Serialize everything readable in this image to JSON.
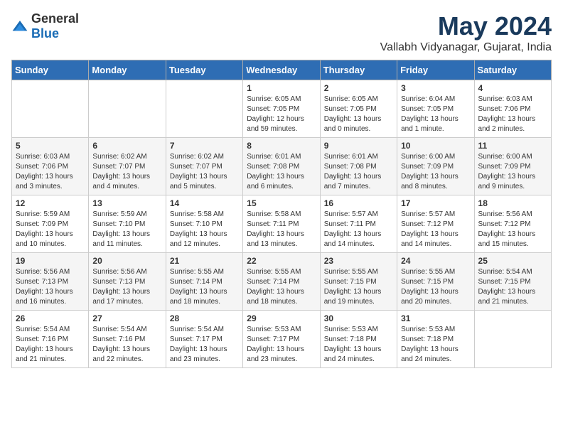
{
  "logo": {
    "text_general": "General",
    "text_blue": "Blue"
  },
  "title": "May 2024",
  "subtitle": "Vallabh Vidyanagar, Gujarat, India",
  "days_of_week": [
    "Sunday",
    "Monday",
    "Tuesday",
    "Wednesday",
    "Thursday",
    "Friday",
    "Saturday"
  ],
  "weeks": [
    [
      {
        "day": "",
        "sunrise": "",
        "sunset": "",
        "daylight": ""
      },
      {
        "day": "",
        "sunrise": "",
        "sunset": "",
        "daylight": ""
      },
      {
        "day": "",
        "sunrise": "",
        "sunset": "",
        "daylight": ""
      },
      {
        "day": "1",
        "sunrise": "Sunrise: 6:05 AM",
        "sunset": "Sunset: 7:05 PM",
        "daylight": "Daylight: 12 hours and 59 minutes."
      },
      {
        "day": "2",
        "sunrise": "Sunrise: 6:05 AM",
        "sunset": "Sunset: 7:05 PM",
        "daylight": "Daylight: 13 hours and 0 minutes."
      },
      {
        "day": "3",
        "sunrise": "Sunrise: 6:04 AM",
        "sunset": "Sunset: 7:05 PM",
        "daylight": "Daylight: 13 hours and 1 minute."
      },
      {
        "day": "4",
        "sunrise": "Sunrise: 6:03 AM",
        "sunset": "Sunset: 7:06 PM",
        "daylight": "Daylight: 13 hours and 2 minutes."
      }
    ],
    [
      {
        "day": "5",
        "sunrise": "Sunrise: 6:03 AM",
        "sunset": "Sunset: 7:06 PM",
        "daylight": "Daylight: 13 hours and 3 minutes."
      },
      {
        "day": "6",
        "sunrise": "Sunrise: 6:02 AM",
        "sunset": "Sunset: 7:07 PM",
        "daylight": "Daylight: 13 hours and 4 minutes."
      },
      {
        "day": "7",
        "sunrise": "Sunrise: 6:02 AM",
        "sunset": "Sunset: 7:07 PM",
        "daylight": "Daylight: 13 hours and 5 minutes."
      },
      {
        "day": "8",
        "sunrise": "Sunrise: 6:01 AM",
        "sunset": "Sunset: 7:08 PM",
        "daylight": "Daylight: 13 hours and 6 minutes."
      },
      {
        "day": "9",
        "sunrise": "Sunrise: 6:01 AM",
        "sunset": "Sunset: 7:08 PM",
        "daylight": "Daylight: 13 hours and 7 minutes."
      },
      {
        "day": "10",
        "sunrise": "Sunrise: 6:00 AM",
        "sunset": "Sunset: 7:09 PM",
        "daylight": "Daylight: 13 hours and 8 minutes."
      },
      {
        "day": "11",
        "sunrise": "Sunrise: 6:00 AM",
        "sunset": "Sunset: 7:09 PM",
        "daylight": "Daylight: 13 hours and 9 minutes."
      }
    ],
    [
      {
        "day": "12",
        "sunrise": "Sunrise: 5:59 AM",
        "sunset": "Sunset: 7:09 PM",
        "daylight": "Daylight: 13 hours and 10 minutes."
      },
      {
        "day": "13",
        "sunrise": "Sunrise: 5:59 AM",
        "sunset": "Sunset: 7:10 PM",
        "daylight": "Daylight: 13 hours and 11 minutes."
      },
      {
        "day": "14",
        "sunrise": "Sunrise: 5:58 AM",
        "sunset": "Sunset: 7:10 PM",
        "daylight": "Daylight: 13 hours and 12 minutes."
      },
      {
        "day": "15",
        "sunrise": "Sunrise: 5:58 AM",
        "sunset": "Sunset: 7:11 PM",
        "daylight": "Daylight: 13 hours and 13 minutes."
      },
      {
        "day": "16",
        "sunrise": "Sunrise: 5:57 AM",
        "sunset": "Sunset: 7:11 PM",
        "daylight": "Daylight: 13 hours and 14 minutes."
      },
      {
        "day": "17",
        "sunrise": "Sunrise: 5:57 AM",
        "sunset": "Sunset: 7:12 PM",
        "daylight": "Daylight: 13 hours and 14 minutes."
      },
      {
        "day": "18",
        "sunrise": "Sunrise: 5:56 AM",
        "sunset": "Sunset: 7:12 PM",
        "daylight": "Daylight: 13 hours and 15 minutes."
      }
    ],
    [
      {
        "day": "19",
        "sunrise": "Sunrise: 5:56 AM",
        "sunset": "Sunset: 7:13 PM",
        "daylight": "Daylight: 13 hours and 16 minutes."
      },
      {
        "day": "20",
        "sunrise": "Sunrise: 5:56 AM",
        "sunset": "Sunset: 7:13 PM",
        "daylight": "Daylight: 13 hours and 17 minutes."
      },
      {
        "day": "21",
        "sunrise": "Sunrise: 5:55 AM",
        "sunset": "Sunset: 7:14 PM",
        "daylight": "Daylight: 13 hours and 18 minutes."
      },
      {
        "day": "22",
        "sunrise": "Sunrise: 5:55 AM",
        "sunset": "Sunset: 7:14 PM",
        "daylight": "Daylight: 13 hours and 18 minutes."
      },
      {
        "day": "23",
        "sunrise": "Sunrise: 5:55 AM",
        "sunset": "Sunset: 7:15 PM",
        "daylight": "Daylight: 13 hours and 19 minutes."
      },
      {
        "day": "24",
        "sunrise": "Sunrise: 5:55 AM",
        "sunset": "Sunset: 7:15 PM",
        "daylight": "Daylight: 13 hours and 20 minutes."
      },
      {
        "day": "25",
        "sunrise": "Sunrise: 5:54 AM",
        "sunset": "Sunset: 7:15 PM",
        "daylight": "Daylight: 13 hours and 21 minutes."
      }
    ],
    [
      {
        "day": "26",
        "sunrise": "Sunrise: 5:54 AM",
        "sunset": "Sunset: 7:16 PM",
        "daylight": "Daylight: 13 hours and 21 minutes."
      },
      {
        "day": "27",
        "sunrise": "Sunrise: 5:54 AM",
        "sunset": "Sunset: 7:16 PM",
        "daylight": "Daylight: 13 hours and 22 minutes."
      },
      {
        "day": "28",
        "sunrise": "Sunrise: 5:54 AM",
        "sunset": "Sunset: 7:17 PM",
        "daylight": "Daylight: 13 hours and 23 minutes."
      },
      {
        "day": "29",
        "sunrise": "Sunrise: 5:53 AM",
        "sunset": "Sunset: 7:17 PM",
        "daylight": "Daylight: 13 hours and 23 minutes."
      },
      {
        "day": "30",
        "sunrise": "Sunrise: 5:53 AM",
        "sunset": "Sunset: 7:18 PM",
        "daylight": "Daylight: 13 hours and 24 minutes."
      },
      {
        "day": "31",
        "sunrise": "Sunrise: 5:53 AM",
        "sunset": "Sunset: 7:18 PM",
        "daylight": "Daylight: 13 hours and 24 minutes."
      },
      {
        "day": "",
        "sunrise": "",
        "sunset": "",
        "daylight": ""
      }
    ]
  ]
}
